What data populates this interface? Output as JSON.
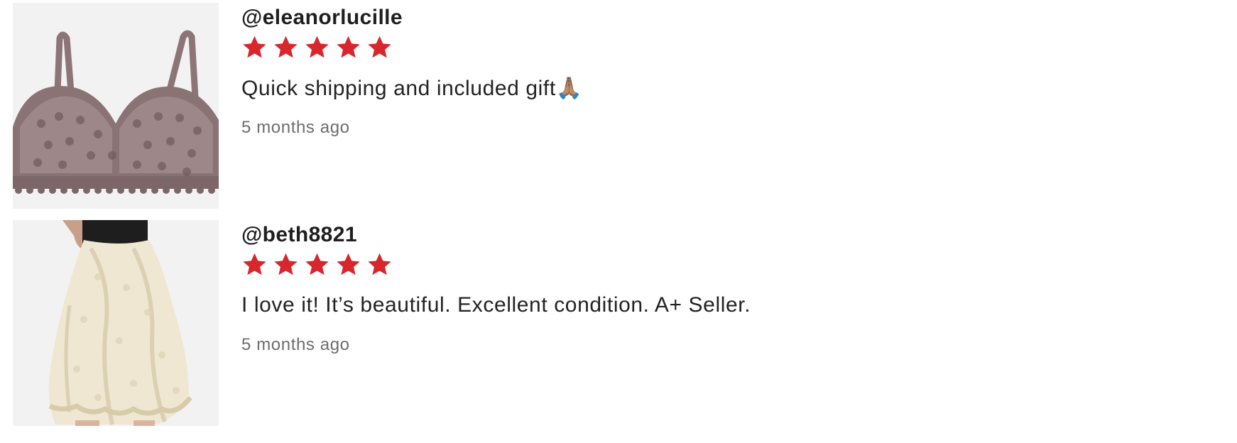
{
  "colors": {
    "star": "#d7262c",
    "username": "#1f1f1f",
    "body_text": "#222222",
    "timestamp": "#6d6d6d",
    "thumb_bg": "#f1f1f1"
  },
  "reviews": [
    {
      "username": "@eleanorlucille",
      "rating": 5,
      "rating_max": 5,
      "text": "Quick shipping and included gift🙏🏽",
      "time": "5 months ago",
      "thumbnail_icon": "bralette-photo"
    },
    {
      "username": "@beth8821",
      "rating": 5,
      "rating_max": 5,
      "text": "I love it! It’s beautiful. Excellent condition. A+ Seller.",
      "time": "5 months ago",
      "thumbnail_icon": "lace-skirt-photo"
    }
  ]
}
